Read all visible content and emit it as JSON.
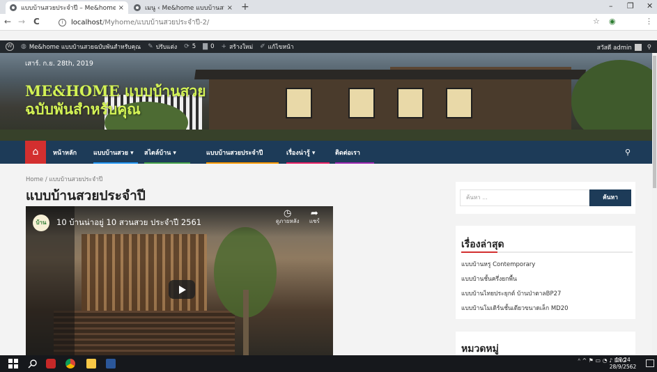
{
  "browser": {
    "tabs": [
      {
        "title": "แบบบ้านสวยประจำปี – Me&home -",
        "close": "×"
      },
      {
        "title": "เมนู ‹ Me&home แบบบ้านสวยฉบับพั",
        "close": "×"
      }
    ],
    "new_tab": "+",
    "window_controls": [
      "–",
      "❐",
      "✕"
    ],
    "nav": {
      "back": "←",
      "forward": "→",
      "reload": "C"
    },
    "url_host": "localhost",
    "url_path": "/Myhome/แบบบ้านสวยประจำปี-2/",
    "url_info": "i",
    "right_icons": [
      "☆",
      "◉",
      "⋮"
    ]
  },
  "adminbar": {
    "wp_logo": "W",
    "site_name": "Me&home แบบบ้านสวยฉบับพันสำหรับคุณ",
    "customize": "ปรับแต่ง",
    "updates": "5",
    "comments": "0",
    "new": "สร้างใหม่",
    "edit": "แก้ไขหน้า",
    "greeting": "สวัสดี admin",
    "search": "⚲"
  },
  "header": {
    "date": "เสาร์. ก.ย. 28th, 2019",
    "site_title": "ME&HOME แบบบ้านสวยฉบับพันสำหรับคุณ"
  },
  "nav": {
    "home_icon": "⌂",
    "items": [
      {
        "label": "หน้าหลัก",
        "color": "#1d3b58"
      },
      {
        "label": "แบบบ้านสวย ▾",
        "color": "#2196f3"
      },
      {
        "label": "สไตล์บ้าน ▾",
        "color": "#43a047"
      },
      {
        "label": "แบบบ้านสวยประจำปี",
        "color": "#ff9800"
      },
      {
        "label": "เรื่องน่ารู้ ▾",
        "color": "#e91e63"
      },
      {
        "label": "ติดต่อเรา",
        "color": "#9c27b0"
      }
    ],
    "search_icon": "⚲"
  },
  "content": {
    "breadcrumb_home": "Home",
    "breadcrumb_sep": "/",
    "breadcrumb_current": "แบบบ้านสวยประจำปี",
    "page_title": "แบบบ้านสวยประจำปี",
    "video": {
      "channel": "บ้าน",
      "title": "10 บ้านน่าอยู่ 10 สวนสวย ประจำปี 2561",
      "watch_later_icon": "◷",
      "watch_later": "ดูภายหลัง",
      "share_icon": "➦",
      "share": "แชร์"
    }
  },
  "sidebar": {
    "search_placeholder": "ค้นหา ...",
    "search_button": "ค้นหา",
    "recent_title": "เรื่องล่าสุด",
    "recent": [
      "แบบบ้านหรู Contemporary",
      "แบบบ้านชั้นครึ่งยกพื้น",
      "แบบบ้านไทยประยุกต์ บ้านป่าตาลBP27",
      "แบบบ้านโมเดิร์นชั้นเดียวขนาดเล็ก MD20"
    ],
    "categories_title": "หมวดหมู่"
  },
  "taskbar": {
    "tray": "ᴬ ^ ⚑ ▭ ◔ ♪ ENG",
    "time": "17:24",
    "date": "28/9/2562"
  }
}
